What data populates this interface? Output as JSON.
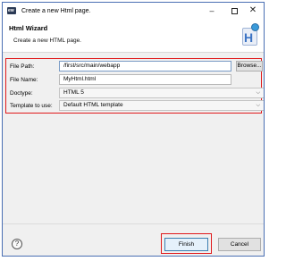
{
  "window": {
    "title": "Create a new Html page.",
    "app_icon_text": "ew"
  },
  "header": {
    "title": "Html Wizard",
    "description": "Create a new HTML page.",
    "icon": "html-page-icon",
    "icon_letter": "H"
  },
  "form": {
    "file_path": {
      "label": "File Path:",
      "value": "/first/src/main/webapp"
    },
    "browse_label": "Browse...",
    "file_name": {
      "label": "File Name:",
      "value": "MyHtml.html"
    },
    "doctype": {
      "label": "Doctype:",
      "value": "HTML 5"
    },
    "template": {
      "label": "Template to use:",
      "value": "Default HTML template"
    }
  },
  "buttons": {
    "help_symbol": "?",
    "finish_label": "Finish",
    "cancel_label": "Cancel"
  },
  "colors": {
    "highlight": "#e0191b",
    "window_border": "#4a6fb3"
  }
}
